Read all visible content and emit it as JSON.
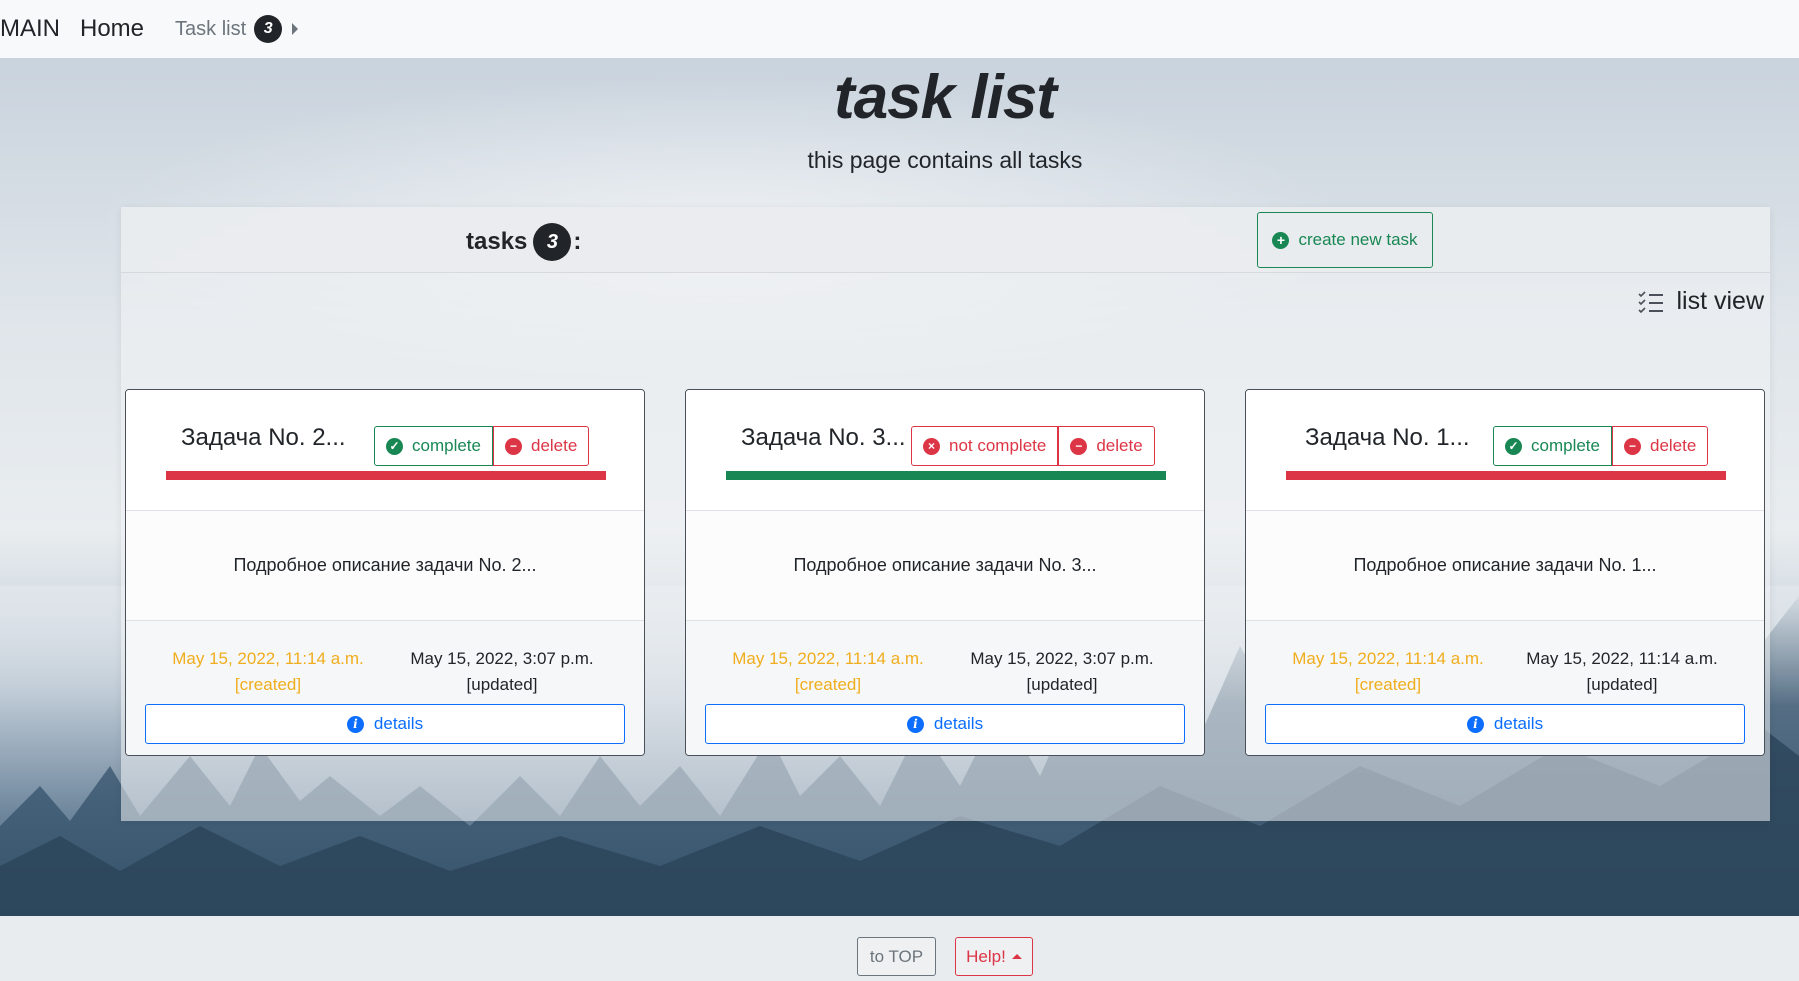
{
  "nav": {
    "brand": "MAIN",
    "home": "Home",
    "task_list": "Task list",
    "task_count": "3"
  },
  "header": {
    "title": "task list",
    "subtitle": "this page contains all tasks"
  },
  "panel": {
    "tasks_label": "tasks",
    "tasks_count": "3",
    "tasks_colon": ":",
    "create_button": "create new task",
    "list_view": "list view"
  },
  "colors": {
    "success": "#198754",
    "danger": "#dc3545",
    "primary": "#0d6efd",
    "warning": "#f0ad1e"
  },
  "tasks": [
    {
      "title": "Задача No. 2...",
      "status_button": "complete",
      "delete_button": "delete",
      "status_bar_color": "#dc3545",
      "description": "Подробное описание задачи No. 2...",
      "created": "May 15, 2022, 11:14 a.m.",
      "created_label": "[created]",
      "updated": "May 15, 2022, 3:07 p.m.",
      "updated_label": "[updated]",
      "details_button": "details"
    },
    {
      "title": "Задача No. 3...",
      "status_button": "not complete",
      "delete_button": "delete",
      "status_bar_color": "#198754",
      "description": "Подробное описание задачи No. 3...",
      "created": "May 15, 2022, 11:14 a.m.",
      "created_label": "[created]",
      "updated": "May 15, 2022, 3:07 p.m.",
      "updated_label": "[updated]",
      "details_button": "details"
    },
    {
      "title": "Задача No. 1...",
      "status_button": "complete",
      "delete_button": "delete",
      "status_bar_color": "#dc3545",
      "description": "Подробное описание задачи No. 1...",
      "created": "May 15, 2022, 11:14 a.m.",
      "created_label": "[created]",
      "updated": "May 15, 2022, 11:14 a.m.",
      "updated_label": "[updated]",
      "details_button": "details"
    }
  ],
  "footer": {
    "to_top": "to TOP",
    "help": "Help!"
  }
}
